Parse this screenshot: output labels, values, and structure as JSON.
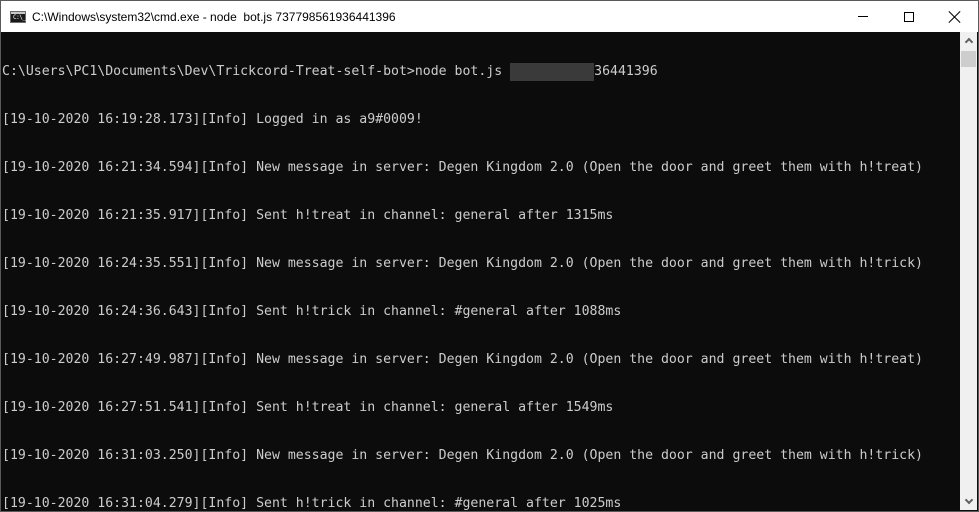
{
  "window": {
    "title": "C:\\Windows\\system32\\cmd.exe - node  bot.js 737798561936441396",
    "icon": "cmd-icon",
    "icon_text": "C:\\_",
    "controls": {
      "minimize": "minimize-icon",
      "maximize": "maximize-icon",
      "close": "close-icon"
    }
  },
  "console": {
    "colors": {
      "background": "#0c0c0c",
      "text": "#cccccc"
    },
    "prompt": "C:\\Users\\PC1\\Documents\\Dev\\Trickcord-Treat-self-bot>node bot.js ",
    "argument_visible_suffix": "36441396",
    "lines": [
      "[19-10-2020 16:19:28.173][Info] Logged in as a9#0009!",
      "[19-10-2020 16:21:34.594][Info] New message in server: Degen Kingdom 2.0 (Open the door and greet them with h!treat)",
      "[19-10-2020 16:21:35.917][Info] Sent h!treat in channel: general after 1315ms",
      "[19-10-2020 16:24:35.551][Info] New message in server: Degen Kingdom 2.0 (Open the door and greet them with h!trick)",
      "[19-10-2020 16:24:36.643][Info] Sent h!trick in channel: #general after 1088ms",
      "[19-10-2020 16:27:49.987][Info] New message in server: Degen Kingdom 2.0 (Open the door and greet them with h!treat)",
      "[19-10-2020 16:27:51.541][Info] Sent h!treat in channel: general after 1549ms",
      "[19-10-2020 16:31:03.250][Info] New message in server: Degen Kingdom 2.0 (Open the door and greet them with h!trick)",
      "[19-10-2020 16:31:04.279][Info] Sent h!trick in channel: #general after 1025ms"
    ]
  }
}
